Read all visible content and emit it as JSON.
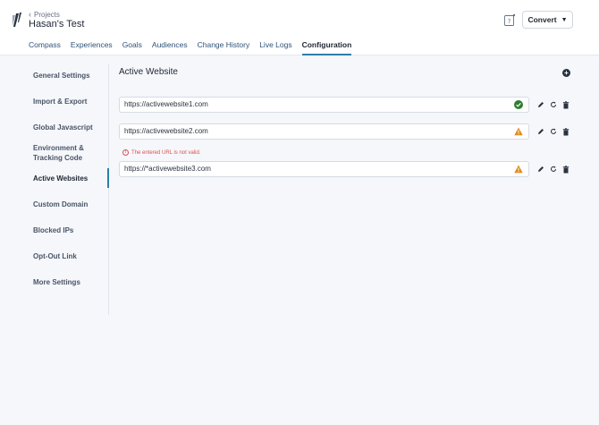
{
  "header": {
    "breadcrumb": "Projects",
    "project_title": "Hasan's Test",
    "convert_label": "Convert",
    "help_icon": "help-icon"
  },
  "tabs": [
    {
      "label": "Compass",
      "active": false
    },
    {
      "label": "Experiences",
      "active": false
    },
    {
      "label": "Goals",
      "active": false
    },
    {
      "label": "Audiences",
      "active": false
    },
    {
      "label": "Change History",
      "active": false
    },
    {
      "label": "Live Logs",
      "active": false
    },
    {
      "label": "Configuration",
      "active": true
    }
  ],
  "sidebar": {
    "items": [
      {
        "label": "General Settings",
        "active": false
      },
      {
        "label": "Import & Export",
        "active": false
      },
      {
        "label": "Global Javascript",
        "active": false
      },
      {
        "label": "Environment & Tracking Code",
        "active": false
      },
      {
        "label": "Active Websites",
        "active": true
      },
      {
        "label": "Custom Domain",
        "active": false
      },
      {
        "label": "Blocked IPs",
        "active": false
      },
      {
        "label": "Opt-Out Link",
        "active": false
      },
      {
        "label": "More Settings",
        "active": false
      }
    ]
  },
  "main": {
    "title": "Active Website",
    "websites": [
      {
        "url": "https://activewebsite1.com",
        "status": "valid"
      },
      {
        "url": "https://activewebsite2.com",
        "status": "warning"
      },
      {
        "url": "https://*activewebsite3.com",
        "status": "warning"
      }
    ],
    "error_message": "The entered URL is not valid."
  },
  "colors": {
    "accent": "#2d7fa6",
    "valid": "#2e7d32",
    "warning": "#e08a1e",
    "error": "#d9534f"
  }
}
